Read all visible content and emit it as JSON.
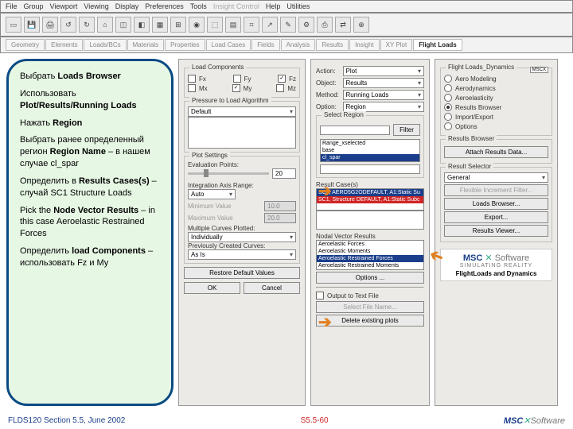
{
  "menubar": [
    "File",
    "Group",
    "Viewport",
    "Viewing",
    "Display",
    "Preferences",
    "Tools",
    "Insight Control",
    "Help",
    "Utilities"
  ],
  "tabs": [
    "Geometry",
    "Elements",
    "Loads/BCs",
    "Materials",
    "Properties",
    "Load Cases",
    "Fields",
    "Analysis",
    "Results",
    "Insight",
    "XY Plot",
    "Flight Loads"
  ],
  "active_tab": "Flight Loads",
  "callout": {
    "p1a": "Выбрать ",
    "p1b": "Loads Browser",
    "p2a": "Использовать ",
    "p2b": "Plot/Results/Running Loads",
    "p3a": "Нажать ",
    "p3b": "Region",
    "p4a": "Выбрать ранее определенный регион ",
    "p4b": "Region Name",
    "p4c": " – в нашем случае cl_spar",
    "p5a": "Определить в ",
    "p5b": "Results Cases(s)",
    "p5c": " – случай SC1 Structure Loads",
    "p6a": "Pick the ",
    "p6b": "Node Vector Results",
    "p6c": " – in this case Aeroelastic Restrained Forces",
    "p7a": "Определить ",
    "p7b": "load Components",
    "p7c": " – использовать Fz и My"
  },
  "panel1": {
    "loadcomp": "Load Components",
    "fx": "Fx",
    "fy": "Fy",
    "fz": "Fz",
    "mx": "Mx",
    "my": "My",
    "mz": "Mz",
    "p2l": "Pressure to Load Algorithm",
    "p2la_val": "Default",
    "plotset": "Plot Settings",
    "evalpts": "Evaluation Points:",
    "eval_val": "20",
    "intaxis": "Integration Axis Range:",
    "auto": "Auto",
    "minv": "Minimum Value",
    "minv_v": "10.0",
    "maxv": "Maximum Value",
    "maxv_v": "20.0",
    "mcp": "Multiple Curves Plotted:",
    "mcp_v": "Individually",
    "pcc": "Previously Created Curves:",
    "pcc_v": "As Is",
    "restore": "Restore Default Values",
    "ok": "OK",
    "cancel": "Cancel"
  },
  "panel2": {
    "action": "Action:",
    "action_v": "Plot",
    "object": "Object:",
    "object_v": "Results",
    "method": "Method:",
    "method_v": "Running Loads",
    "option": "Option:",
    "option_v": "Region",
    "selreg": "Select Region",
    "filter": "Filter",
    "reg1": "Range_xselected",
    "reg2": "base",
    "reg3": "cl_spar",
    "rc": "Result Case(s)",
    "rc1": "SC1, AERO5G2ODEFAULT, A1:Static Su",
    "rc2": "SC1, Structure DEFAULT, A1:Static Subc",
    "nvr": "Nodal Vector Results",
    "nvr1": "Aeroelastic Forces",
    "nvr2": "Aeroelastic Moments",
    "nvr3": "Aeroelastic Restrained Forces",
    "nvr4": "Aeroelastic Restrained Moments",
    "options": "Options ...",
    "out": "Output to Text File",
    "sfn": "Select File Name...",
    "dep": "Delete existing plots"
  },
  "panel3": {
    "title": "Flight Loads_Dynamics",
    "r1": "Aero Modeling",
    "r2": "Aerodynamics",
    "r3": "Aeroelasticity",
    "r4": "Results Browser",
    "r5": "Import/Export",
    "r6": "Options",
    "rb": "Results Browser",
    "ard": "Attach Results Data...",
    "rs": "Result Selector",
    "gen": "General",
    "fif": "Flexible Increment Filter...",
    "lb": "Loads Browser...",
    "exp": "Export...",
    "rv": "Results Viewer...",
    "msc": "MSC",
    "soft": "Software",
    "tag": "FlightLoads and Dynamics"
  },
  "footer": {
    "left": "FLDS120 Section 5.5, June 2002",
    "mid": "S5.5-60"
  }
}
